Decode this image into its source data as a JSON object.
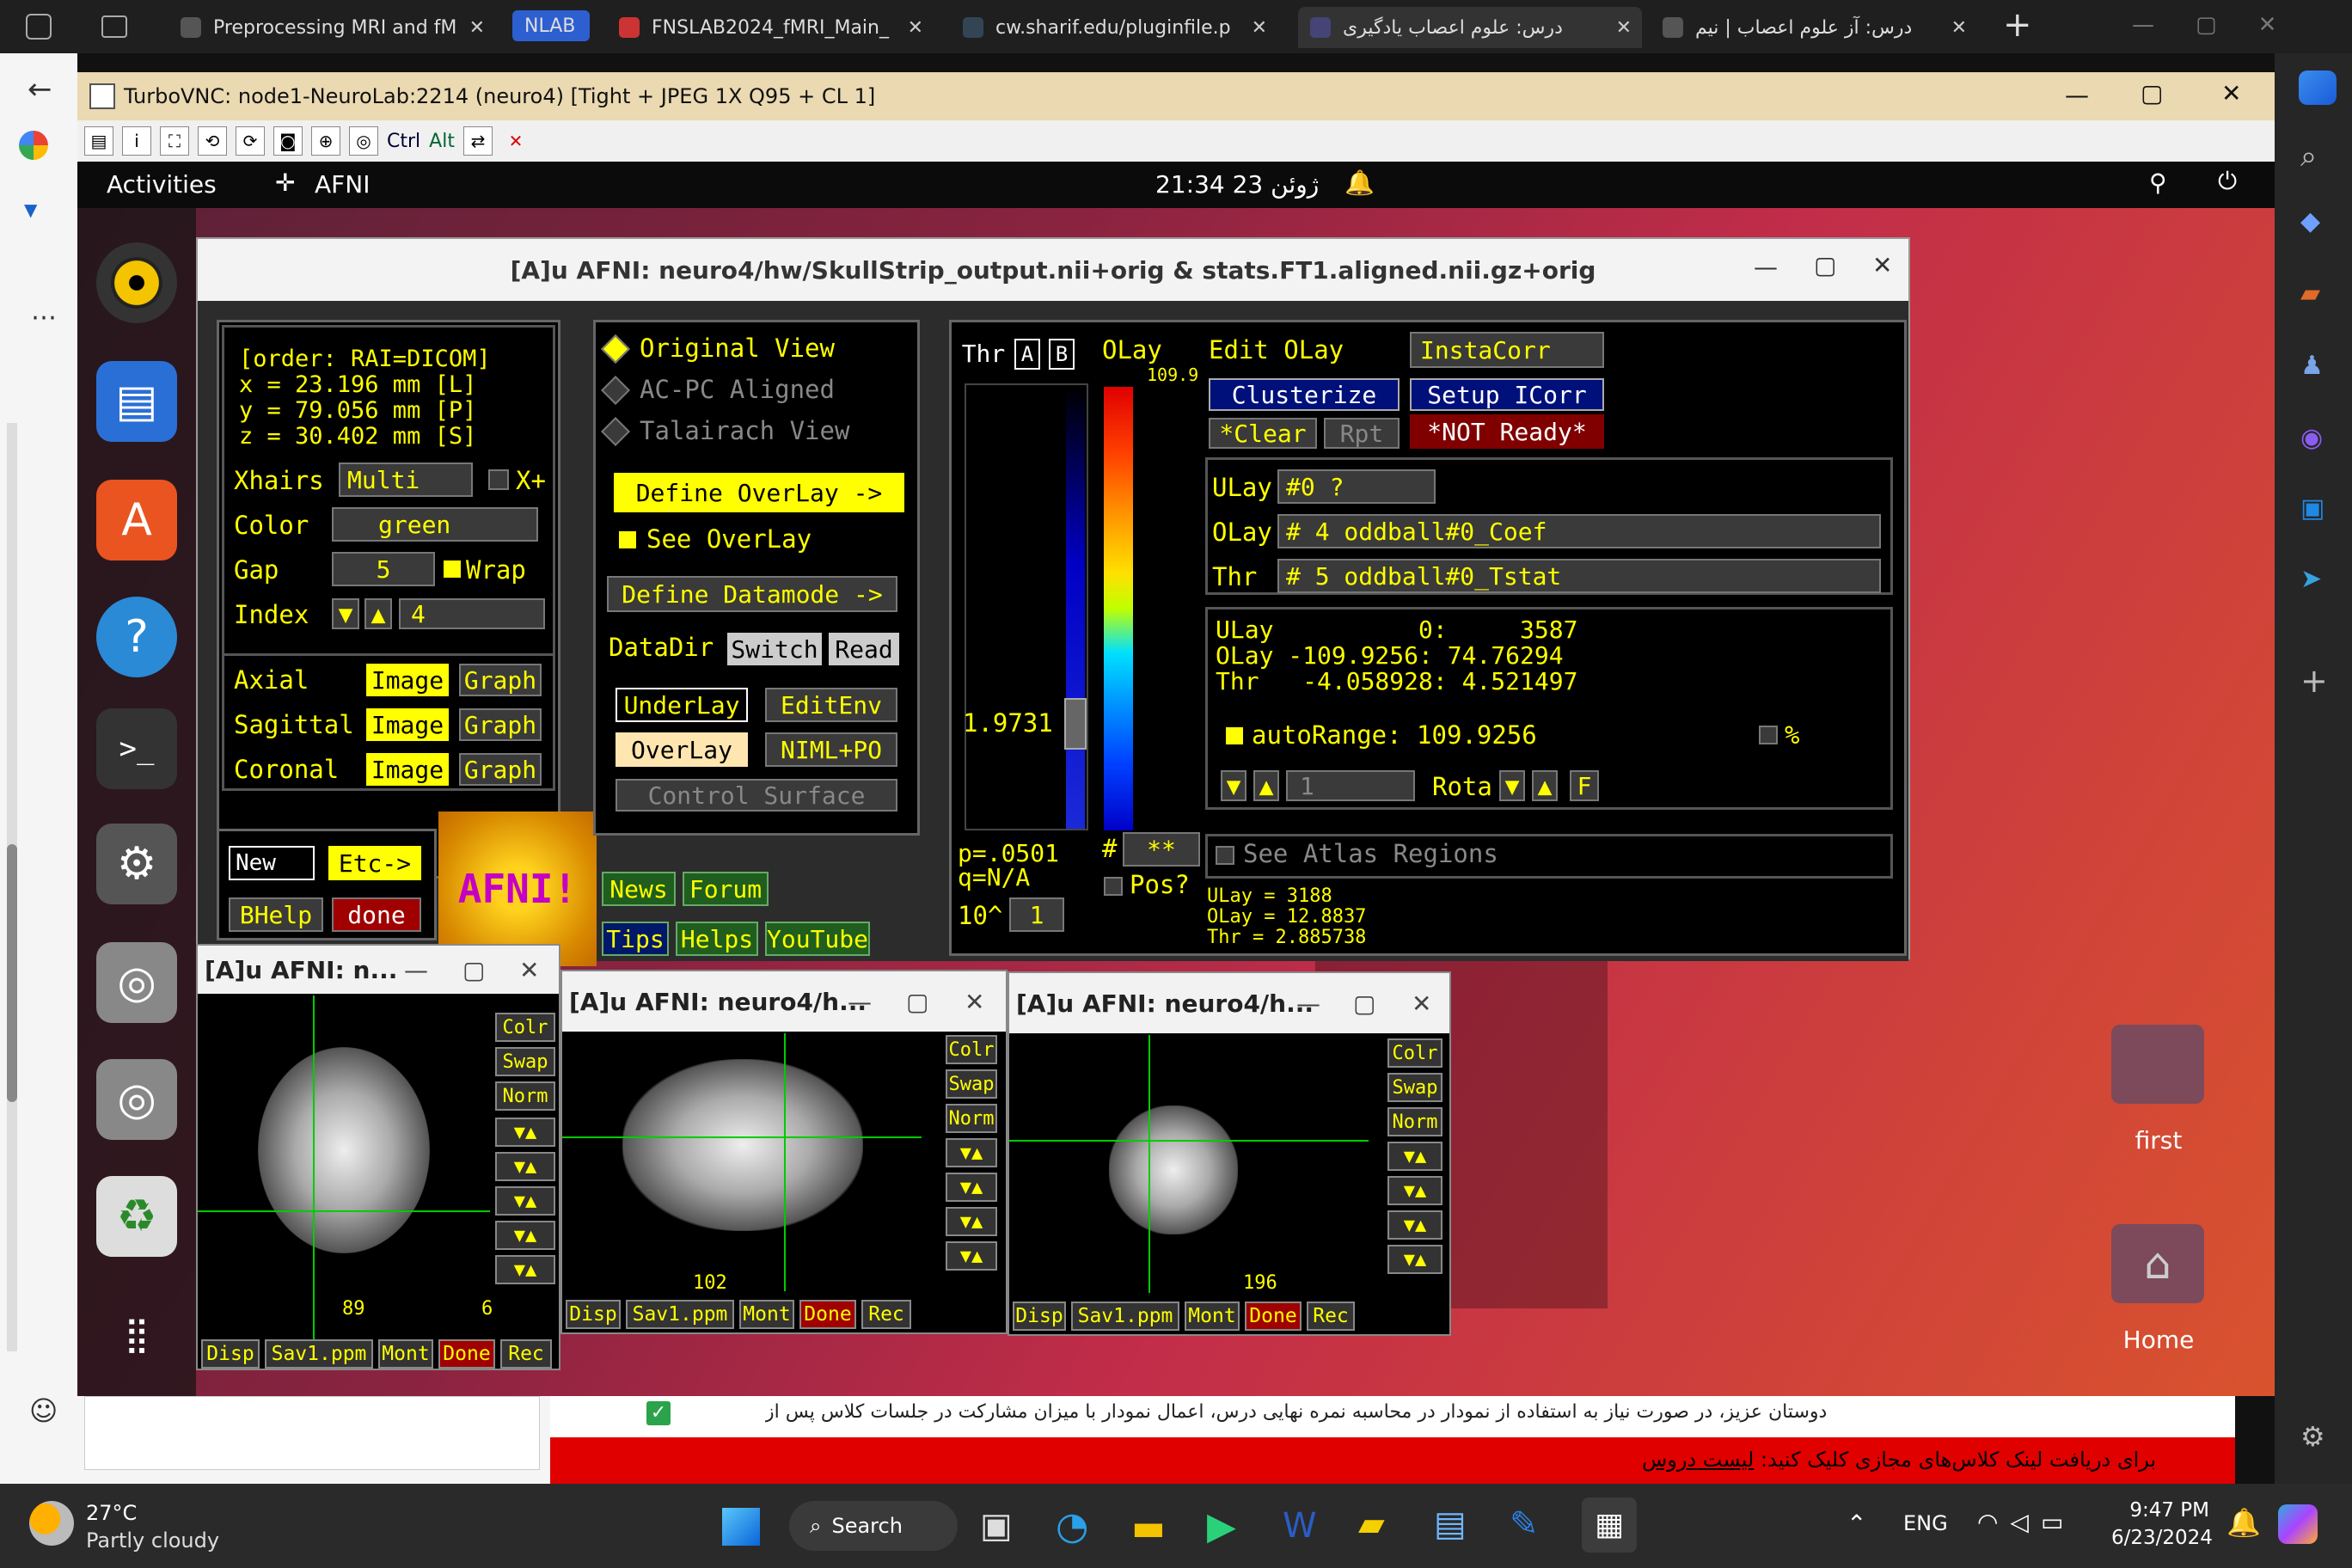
{
  "browser": {
    "tabs": [
      {
        "label": "Preprocessing MRI and fM"
      },
      {
        "label": "NLAB"
      },
      {
        "label": "FNSLAB2024_fMRI_Main_"
      },
      {
        "label": "cw.sharif.edu/pluginfile.p"
      },
      {
        "label": "درس: علوم اعصاب یادگیری"
      },
      {
        "label": "درس: آز علوم اعصاب | نیم"
      }
    ]
  },
  "vnc": {
    "title": "TurboVNC: node1-NeuroLab:2214 (neuro4) [Tight + JPEG 1X Q95 + CL 1]",
    "toolbar": {
      "ctrl": "Ctrl",
      "alt": "Alt"
    }
  },
  "gnome": {
    "activities": "Activities",
    "app": "AFNI",
    "clock": "21:34 23 ژوئن"
  },
  "afni": {
    "title": "[A]u AFNI: neuro4/hw/SkullStrip_output.nii+orig & stats.FT1.aligned.nii.gz+orig",
    "coords": {
      "order": "[order: RAI=DICOM]",
      "x": "x =   23.196 mm [L]",
      "y": "y =   79.056 mm [P]",
      "z": "z =   30.402 mm [S]"
    },
    "xhairs_label": "Xhairs",
    "xhairs_value": "Multi",
    "xplus": "X+",
    "color_label": "Color",
    "color_value": "green",
    "gap_label": "Gap",
    "gap_value": "5",
    "wrap": "Wrap",
    "index_label": "Index",
    "index_value": "4",
    "views": [
      {
        "label": "Axial"
      },
      {
        "label": "Sagittal"
      },
      {
        "label": "Coronal"
      }
    ],
    "image": "Image",
    "graph": "Graph",
    "new": "New",
    "etc": "Etc->",
    "bhelp": "BHelp",
    "done": "done",
    "logo": "AFNI!",
    "view_options": {
      "original": "Original View",
      "acpc": "AC-PC Aligned",
      "talairach": "Talairach View"
    },
    "define_overlay": "Define OverLay ->",
    "see_overlay": "See OverLay",
    "define_datamode": "Define Datamode ->",
    "datadir": "DataDir",
    "switch": "Switch",
    "read": "Read",
    "underlay": "UnderLay",
    "editenv": "EditEnv",
    "overlay": "OverLay",
    "niml": "NIML+PO",
    "control_surface": "Control Surface",
    "news": "News",
    "forum": "Forum",
    "tips": "Tips",
    "helps": "Helps",
    "youtube": "YouTube",
    "thr": "Thr",
    "a": "A",
    "b": "B",
    "olay": "OLay",
    "olay_max": "109.9",
    "thr_value": "1.9731",
    "p_value": "p=.0501",
    "q_value": "q=N/A",
    "pow": "10^",
    "pow_value": "1",
    "stars": "**",
    "pos": "Pos?",
    "edit_olay": "Edit OLay",
    "instacorr": "InstaCorr",
    "clusterize": "Clusterize",
    "setup_icorr": "Setup ICorr",
    "clear": "*Clear",
    "rpt": "Rpt",
    "not_ready": "*NOT Ready*",
    "ulay_label": "ULay",
    "ulay_value": "#0 ?",
    "olay_label": "OLay",
    "olay_value": "# 4 oddball#0_Coef",
    "thr_label": "Thr",
    "thr_sel": "# 5 oddball#0_Tstat",
    "info": {
      "ulay": "ULay          0:     3587",
      "olay": "OLay -109.9256: 74.76294",
      "thr": "Thr   -4.058928: 4.521497"
    },
    "autorange": "autoRange: 109.9256",
    "percent": "%",
    "rota": "Rota",
    "rota_value": "1",
    "f": "F",
    "atlas": "See Atlas Regions",
    "vals": {
      "ulay": "ULay = 3188",
      "olay": "OLay = 12.8837",
      "thr": "Thr  = 2.885738"
    }
  },
  "image_windows": [
    {
      "title": "[A]u AFNI: n...",
      "slice": "89",
      "extra": "6"
    },
    {
      "title": "[A]u AFNI: neuro4/h...",
      "slice": "102"
    },
    {
      "title": "[A]u AFNI: neuro4/h...",
      "slice": "196"
    }
  ],
  "image_side": {
    "colr": "Colr",
    "swap": "Swap",
    "norm": "Norm"
  },
  "image_bottom": {
    "disp": "Disp",
    "sav": "Sav1.ppm",
    "mont": "Mont",
    "done": "Done",
    "rec": "Rec"
  },
  "desktop": {
    "folder": "first",
    "home": "Home"
  },
  "page_footer": {
    "notice": "دوستان عزیز، در صورت نیاز به استفاده از نمودار در محاسبه نمره نهایی درس، اعمال نمودار با میزان مشارکت در جلسات کلاس پس از",
    "banner": "برای دریافت لینک کلاس‌های مجازی کلیک کنید:",
    "banner_link": "لیست دروس"
  },
  "taskbar": {
    "weather_temp": "27°C",
    "weather_desc": "Partly cloudy",
    "search": "Search",
    "lang": "ENG",
    "time": "9:47 PM",
    "date": "6/23/2024"
  }
}
